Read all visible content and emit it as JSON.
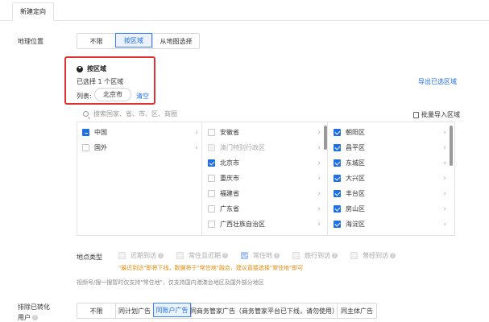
{
  "tabs": {
    "active": "新建定向"
  },
  "geo": {
    "label": "地理位置",
    "options": [
      "不限",
      "按区域",
      "从地图选择"
    ],
    "selected": "按区域",
    "summary": {
      "title": "按区域",
      "count_text": "已选择 1 个区域",
      "list_label": "列表:",
      "chip": "北京市",
      "clear": "清空"
    },
    "export_link": "导出已选区域",
    "search_placeholder": "搜索国家、省、市、区、商圈",
    "batch_import": "批量导入区域",
    "col1": [
      {
        "label": "中国",
        "state": "half"
      },
      {
        "label": "国外",
        "state": "off"
      }
    ],
    "col2": [
      {
        "label": "安徽省",
        "state": "off"
      },
      {
        "label": "澳门特别行政区",
        "state": "disabled"
      },
      {
        "label": "北京市",
        "state": "on"
      },
      {
        "label": "重庆市",
        "state": "off"
      },
      {
        "label": "福建省",
        "state": "off"
      },
      {
        "label": "广东省",
        "state": "off"
      },
      {
        "label": "广西壮族自治区",
        "state": "off"
      }
    ],
    "col3": [
      {
        "label": "朝阳区",
        "state": "on"
      },
      {
        "label": "昌平区",
        "state": "on"
      },
      {
        "label": "东城区",
        "state": "on"
      },
      {
        "label": "大兴区",
        "state": "on"
      },
      {
        "label": "丰台区",
        "state": "on"
      },
      {
        "label": "房山区",
        "state": "on"
      },
      {
        "label": "海淀区",
        "state": "on"
      }
    ]
  },
  "location_type": {
    "label": "地点类型",
    "options": [
      {
        "label": "近期到访",
        "checked": false
      },
      {
        "label": "常住且近期",
        "checked": false
      },
      {
        "label": "常住地",
        "checked": true
      },
      {
        "label": "旅行到访",
        "checked": false
      },
      {
        "label": "曾经到访",
        "checked": false
      }
    ],
    "warning": "\"最近到访\"即将下线，数据将于\"常住地\"融合，建议直接选择\"常住地\"即可",
    "note": "视频号/搜一搜暂时仅支持\"常住地\"，仅支持国内港澳台地区及国外部分地区"
  },
  "exclude": {
    "label_line1": "排除已转化",
    "label_line2": "用户",
    "options": [
      "不限",
      "同计划广告",
      "同账户广告",
      "同商务管家广告（商务管家平台已下线，请勿使用）",
      "同主体广告"
    ],
    "selected": "同账户广告"
  }
}
